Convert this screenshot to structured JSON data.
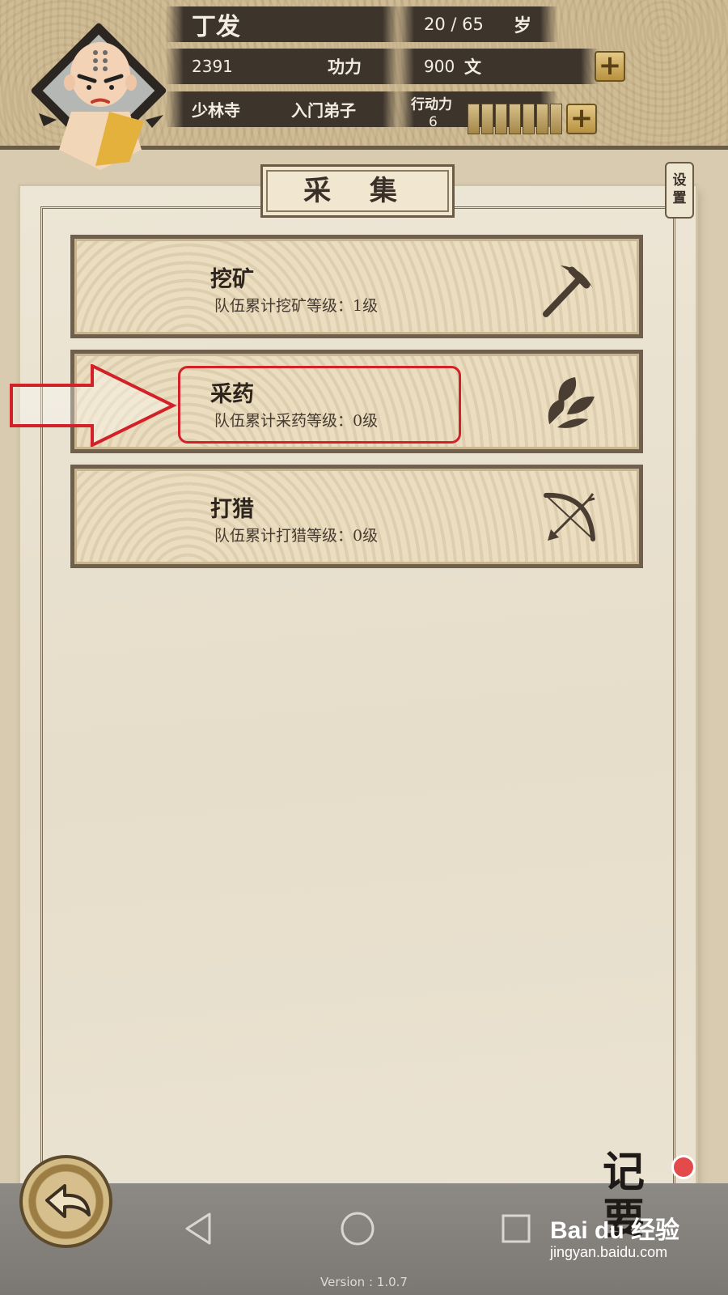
{
  "header": {
    "name": "丁发",
    "age": "20 / 65",
    "age_unit": "岁",
    "power_value": "2391",
    "power_label": "功力",
    "money_value": "900",
    "money_unit": "文",
    "sect": "少林寺",
    "rank": "入门弟子",
    "action_label": "行动力",
    "action_value": "6",
    "action_cells": 7
  },
  "panel": {
    "title": "采 集",
    "settings_label": "设\n置"
  },
  "activities": [
    {
      "title": "挖矿",
      "subtitle": "队伍累计挖矿等级：1级",
      "icon": "pickaxe-icon"
    },
    {
      "title": "采药",
      "subtitle": "队伍累计采药等级：0级",
      "icon": "herb-leaves-icon"
    },
    {
      "title": "打猎",
      "subtitle": "队伍累计打猎等级：0级",
      "icon": "bow-arrow-icon"
    }
  ],
  "bottom": {
    "memo_text": "记\n要",
    "version": "Version : 1.0.7",
    "watermark_brand": "Bai du 经验",
    "watermark_url": "jingyan.baidu.com"
  },
  "colors": {
    "header_bar": "#3d342c",
    "card_border": "#6e604c",
    "highlight_red": "#d32129",
    "gold_button": "#c9a85a"
  }
}
